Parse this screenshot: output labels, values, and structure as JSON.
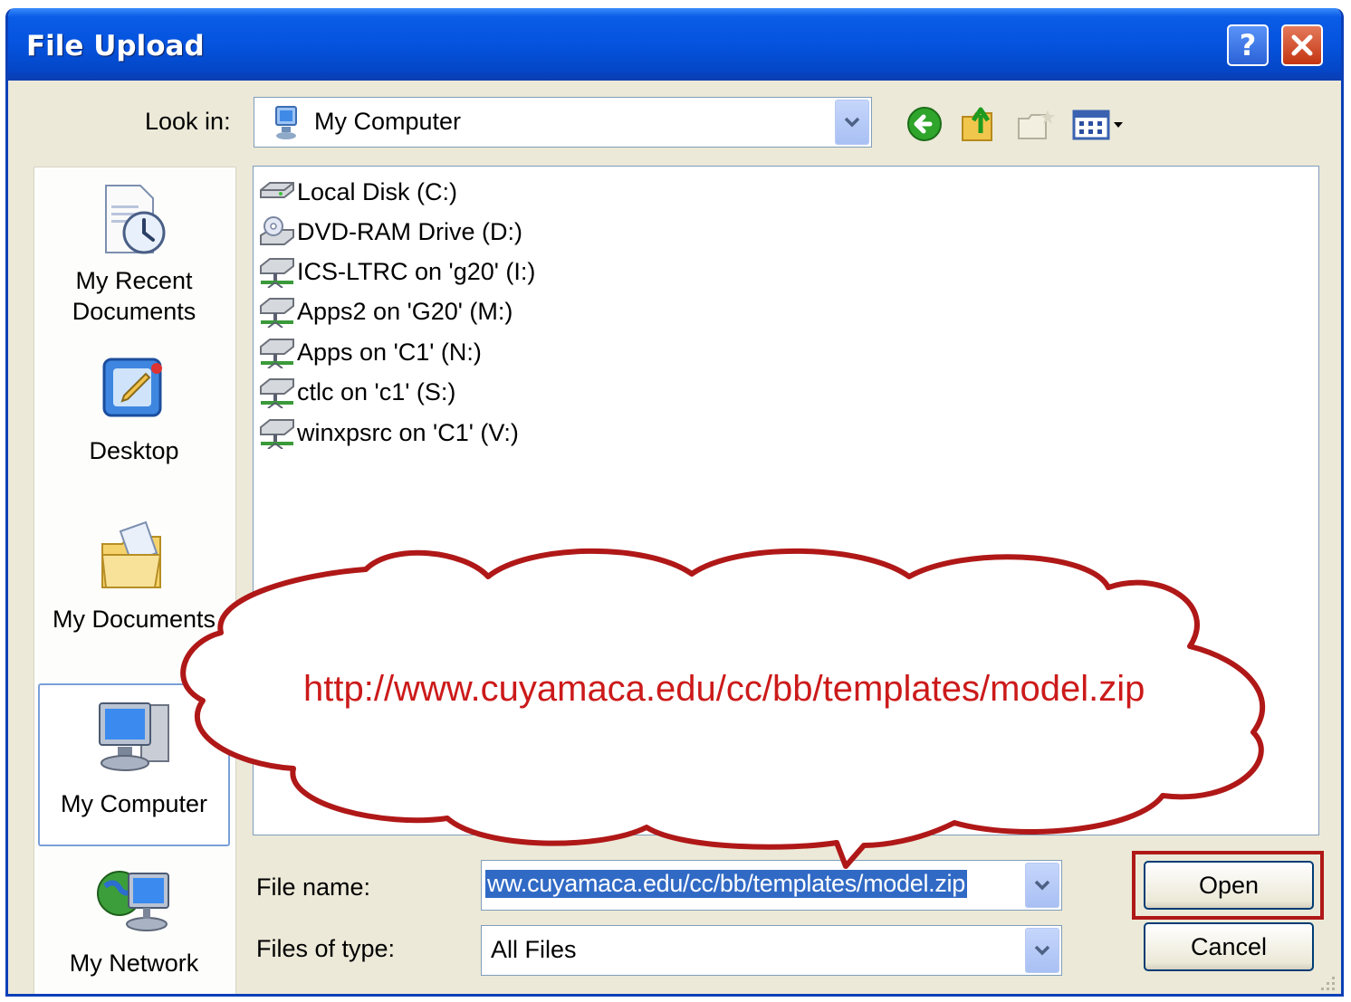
{
  "window": {
    "title": "File Upload",
    "help_label": "?",
    "close_label": "✕"
  },
  "toolbar": {
    "look_in_label": "Look in:",
    "look_in_value": "My Computer",
    "icons": [
      "back-icon",
      "up-folder-icon",
      "new-folder-icon",
      "views-menu-icon"
    ]
  },
  "places": [
    {
      "label_line1": "My Recent",
      "label_line2": "Documents",
      "icon": "recent-documents-icon"
    },
    {
      "label_line1": "Desktop",
      "label_line2": "",
      "icon": "desktop-icon"
    },
    {
      "label_line1": "My Documents",
      "label_line2": "",
      "icon": "my-documents-icon"
    },
    {
      "label_line1": "My Computer",
      "label_line2": "",
      "icon": "my-computer-icon",
      "selected": true
    },
    {
      "label_line1": "My Network",
      "label_line2": "",
      "icon": "my-network-icon"
    }
  ],
  "files": [
    {
      "name": "Local Disk (C:)",
      "icon": "hard-disk-icon"
    },
    {
      "name": "DVD-RAM Drive (D:)",
      "icon": "dvd-drive-icon"
    },
    {
      "name": "ICS-LTRC on 'g20' (I:)",
      "icon": "network-drive-icon"
    },
    {
      "name": "Apps2 on 'G20' (M:)",
      "icon": "network-drive-icon"
    },
    {
      "name": "Apps on 'C1' (N:)",
      "icon": "network-drive-icon"
    },
    {
      "name": "ctlc on 'c1' (S:)",
      "icon": "network-drive-icon"
    },
    {
      "name": "winxpsrc on 'C1' (V:)",
      "icon": "network-drive-icon"
    }
  ],
  "form": {
    "file_name_label": "File name:",
    "file_name_value": "ww.cuyamaca.edu/cc/bb/templates/model.zip",
    "files_of_type_label": "Files of type:",
    "files_of_type_value": "All Files"
  },
  "buttons": {
    "open": "Open",
    "cancel": "Cancel"
  },
  "callout": {
    "text": "http://www.cuyamaca.edu/cc/bb/templates/model.zip"
  },
  "colors": {
    "titlebar": "#0553de",
    "callout_border": "#b01818",
    "callout_text": "#cc1a1a",
    "highlight_box": "#b01818",
    "selection": "#316ac5"
  }
}
